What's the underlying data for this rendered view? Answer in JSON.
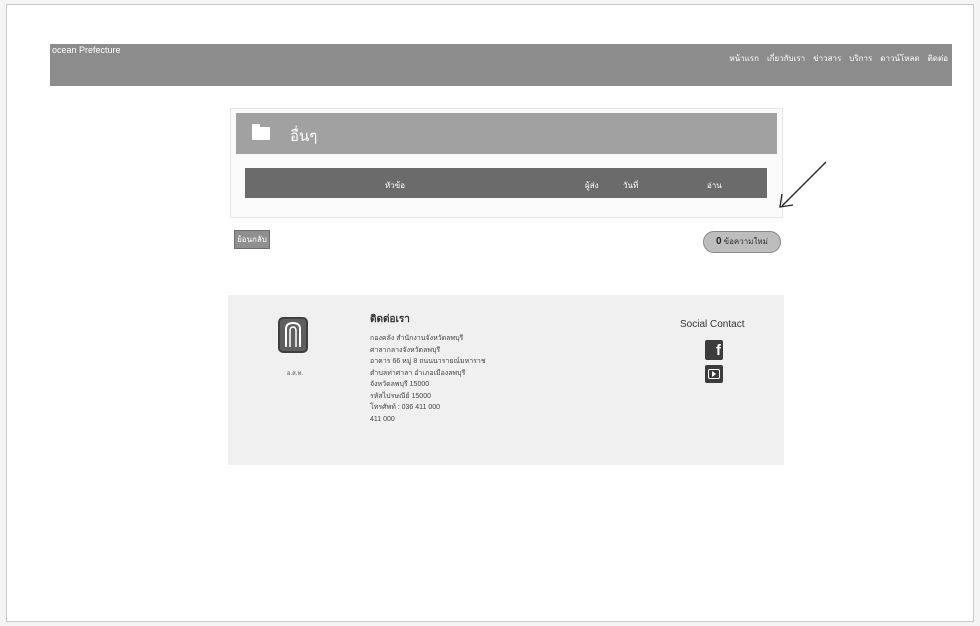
{
  "nav": {
    "brand": "ocean Prefecture",
    "links": [
      "หน้าแรก",
      "เกี่ยวกับเรา",
      "ข่าวสาร",
      "บริการ",
      "ดาวน์โหลด",
      "ติดต่อ"
    ]
  },
  "panel": {
    "title": "อื่นๆ",
    "columns": [
      "หัวข้อ",
      "ผู้ส่ง",
      "วันที่",
      "อ่าน"
    ]
  },
  "actions": {
    "back_label": "ย้อนกลับ",
    "count": "0",
    "count_label": "ข้อความใหม่"
  },
  "footer": {
    "logo_caption": "อ.ส.ท.",
    "contact_title": "ติดต่อเรา",
    "contact_lines": [
      "กองคลัง สำนักงานจังหวัดลพบุรี",
      "ศาลากลางจังหวัดลพบุรี",
      "อาคาร 66 หมู่ 8 ถนนนารายณ์มหาราช",
      "ตำบลท่าศาลา อำเภอเมืองลพบุรี",
      "จังหวัดลพบุรี 15000",
      "รหัสไปรษณีย์ 15000",
      "โทรศัพท์ : 036 411 000",
      "411 000"
    ],
    "social_title": "Social Contact"
  },
  "colors": {
    "nav_bg": "#8c8c8c",
    "panel_header_bg": "#a1a1a1",
    "table_head_bg": "#6b6b6b"
  }
}
